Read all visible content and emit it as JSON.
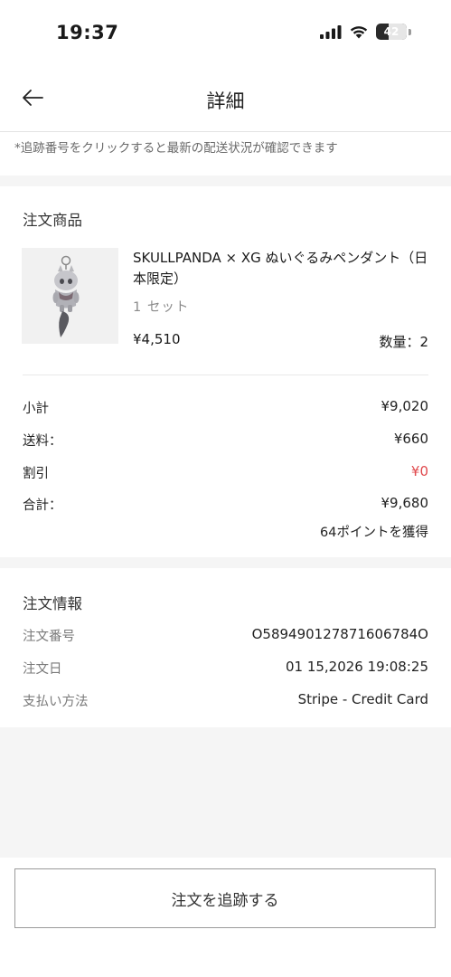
{
  "status_bar": {
    "time": "19:37",
    "battery": "42",
    "battery_level": 0.42
  },
  "nav": {
    "title": "詳細"
  },
  "hint": "*追跡番号をクリックすると最新の配送状況が確認できます",
  "order_items": {
    "title": "注文商品",
    "product": {
      "name": "SKULLPANDA × XG ぬいぐるみペンダント（日本限定）",
      "variant": "1 セット",
      "price": "¥4,510",
      "quantity": "数量：2"
    }
  },
  "summary": {
    "subtotal": {
      "label": "小計",
      "value": "¥9,020"
    },
    "shipping": {
      "label": "送料：",
      "value": "¥660"
    },
    "discount": {
      "label": "割引",
      "value": "¥0"
    },
    "total": {
      "label": "合計：",
      "value": "¥9,680"
    },
    "points": "64ポイントを獲得"
  },
  "order_info": {
    "title": "注文情報",
    "order_number": {
      "label": "注文番号",
      "value": "O589490127871606784O"
    },
    "order_date": {
      "label": "注文日",
      "value": "01 15,2026 19:08:25"
    },
    "payment": {
      "label": "支払い方法",
      "value": "Stripe - Credit Card"
    }
  },
  "track_button": "注文を追跡する",
  "colors": {
    "discount_red": "#e0494d",
    "gap_gray": "#f5f5f5"
  }
}
